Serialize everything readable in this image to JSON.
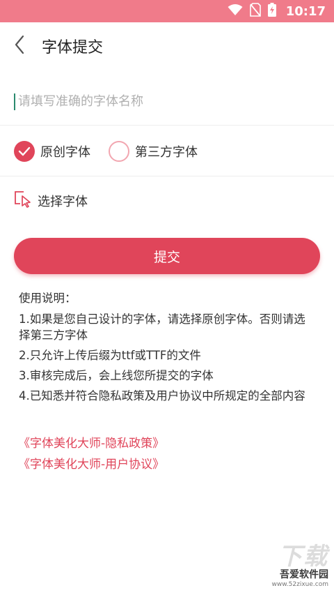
{
  "status_bar": {
    "time": "10:17",
    "icons": [
      "wifi-icon",
      "no-sim-icon",
      "battery-charging-icon"
    ]
  },
  "header": {
    "title": "字体提交",
    "back_icon": "chevron-left-icon"
  },
  "form": {
    "name_placeholder": "请填写准确的字体名称",
    "name_value": "",
    "radio_options": [
      {
        "label": "原创字体",
        "checked": true
      },
      {
        "label": "第三方字体",
        "checked": false
      }
    ],
    "select_font_label": "选择字体",
    "select_font_icon": "cursor-select-icon",
    "submit_label": "提交"
  },
  "instructions": {
    "title": "使用说明：",
    "items": [
      "1.如果是您自己设计的字体，请选择原创字体。否则请选择第三方字体",
      "2.只允许上传后缀为ttf或TTF的文件",
      "3.审核完成后，会上线您所提交的字体",
      "4.已知悉并符合隐私政策及用户协议中所规定的全部内容"
    ]
  },
  "links": {
    "privacy": "《字体美化大师-隐私政策》",
    "user_agreement": "《字体美化大师-用户协议》"
  },
  "watermark": {
    "big_text": "下载",
    "name": "吾爱软件园",
    "url": "www.52zixue.com"
  },
  "colors": {
    "accent": "#e0455a",
    "status_bar": "#f07b8a",
    "radio_unchecked_border": "#f2a6b0"
  }
}
